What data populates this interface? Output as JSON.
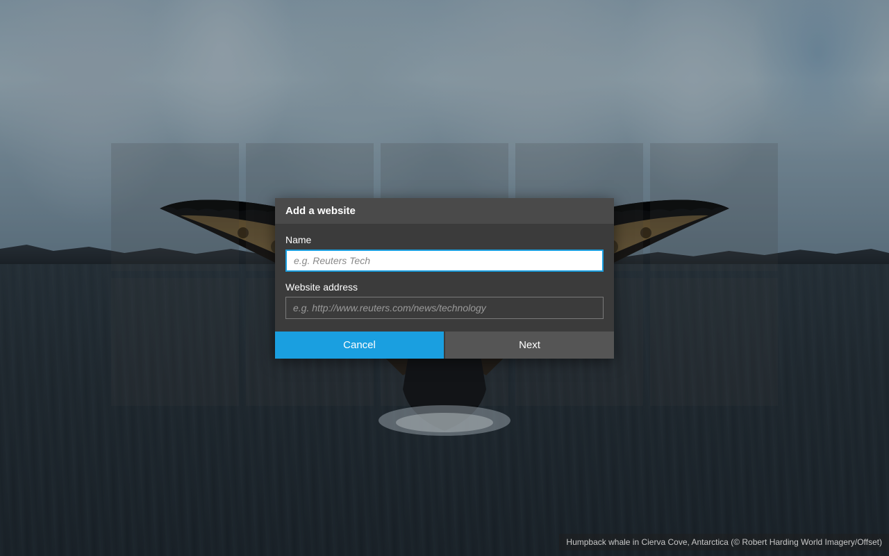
{
  "dialog": {
    "title": "Add a website",
    "name_label": "Name",
    "name_placeholder": "e.g. Reuters Tech",
    "name_value": "",
    "address_label": "Website address",
    "address_placeholder": "e.g. http://www.reuters.com/news/technology",
    "address_value": "",
    "cancel_label": "Cancel",
    "next_label": "Next"
  },
  "caption": "Humpback whale in Cierva Cove, Antarctica (© Robert Harding World Imagery/Offset)",
  "colors": {
    "accent": "#1a9fe0",
    "dialog_bg": "#3b3b3b",
    "dialog_header": "#4a4a4a"
  }
}
